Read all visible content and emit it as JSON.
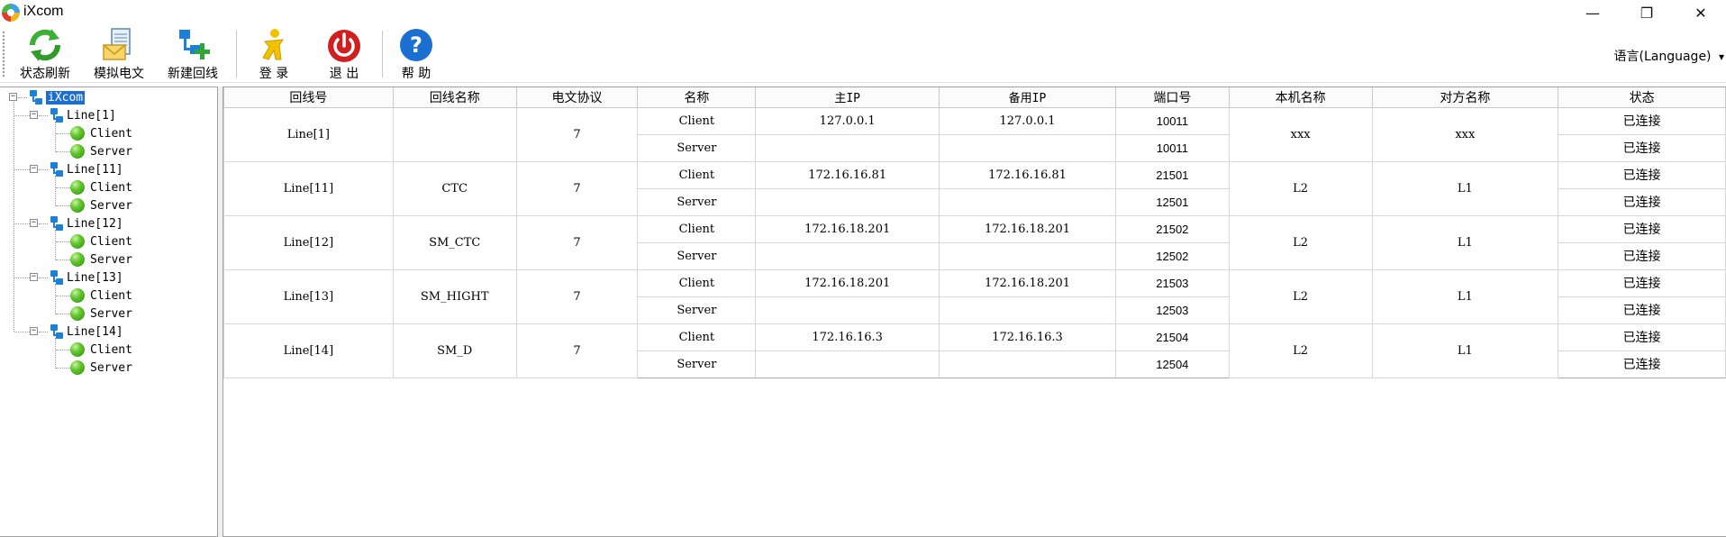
{
  "window": {
    "title": "iXcom",
    "minimize_glyph": "—",
    "restore_glyph": "❐",
    "close_glyph": "✕"
  },
  "toolbar": {
    "buttons": [
      {
        "label": "状态刷新",
        "icon": "refresh-icon"
      },
      {
        "label": "模拟电文",
        "icon": "message-icon"
      },
      {
        "label": "新建回线",
        "icon": "new-line-icon"
      },
      {
        "label": "登 录",
        "icon": "login-icon"
      },
      {
        "label": "退 出",
        "icon": "power-icon"
      },
      {
        "label": "帮 助",
        "icon": "help-icon"
      }
    ],
    "language": "语言(Language)",
    "language_arrow": "▾"
  },
  "tree": {
    "root": "iXcom",
    "lines": [
      {
        "label": "Line[1]",
        "children": [
          "Client",
          "Server"
        ]
      },
      {
        "label": "Line[11]",
        "children": [
          "Client",
          "Server"
        ]
      },
      {
        "label": "Line[12]",
        "children": [
          "Client",
          "Server"
        ]
      },
      {
        "label": "Line[13]",
        "children": [
          "Client",
          "Server"
        ]
      },
      {
        "label": "Line[14]",
        "children": [
          "Client",
          "Server"
        ]
      }
    ]
  },
  "table": {
    "columns": [
      "回线号",
      "回线名称",
      "电文协议",
      "名称",
      "主IP",
      "备用IP",
      "端口号",
      "本机名称",
      "对方名称",
      "状态"
    ],
    "groups": [
      {
        "line": "Line[1]",
        "name": "",
        "protocol": "7",
        "local": "xxx",
        "remote": "xxx",
        "rows": [
          {
            "role": "Client",
            "main_ip": "127.0.0.1",
            "backup_ip": "127.0.0.1",
            "port": "10011",
            "status": "已连接"
          },
          {
            "role": "Server",
            "main_ip": "",
            "backup_ip": "",
            "port": "10011",
            "status": "已连接"
          }
        ]
      },
      {
        "line": "Line[11]",
        "name": "CTC",
        "protocol": "7",
        "local": "L2",
        "remote": "L1",
        "rows": [
          {
            "role": "Client",
            "main_ip": "172.16.16.81",
            "backup_ip": "172.16.16.81",
            "port": "21501",
            "status": "已连接"
          },
          {
            "role": "Server",
            "main_ip": "",
            "backup_ip": "",
            "port": "12501",
            "status": "已连接"
          }
        ]
      },
      {
        "line": "Line[12]",
        "name": "SM_CTC",
        "protocol": "7",
        "local": "L2",
        "remote": "L1",
        "rows": [
          {
            "role": "Client",
            "main_ip": "172.16.18.201",
            "backup_ip": "172.16.18.201",
            "port": "21502",
            "status": "已连接"
          },
          {
            "role": "Server",
            "main_ip": "",
            "backup_ip": "",
            "port": "12502",
            "status": "已连接"
          }
        ]
      },
      {
        "line": "Line[13]",
        "name": "SM_HIGHT",
        "protocol": "7",
        "local": "L2",
        "remote": "L1",
        "rows": [
          {
            "role": "Client",
            "main_ip": "172.16.18.201",
            "backup_ip": "172.16.18.201",
            "port": "21503",
            "status": "已连接"
          },
          {
            "role": "Server",
            "main_ip": "",
            "backup_ip": "",
            "port": "12503",
            "status": "已连接"
          }
        ]
      },
      {
        "line": "Line[14]",
        "name": "SM_D",
        "protocol": "7",
        "local": "L2",
        "remote": "L1",
        "rows": [
          {
            "role": "Client",
            "main_ip": "172.16.16.3",
            "backup_ip": "172.16.16.3",
            "port": "21504",
            "status": "已连接"
          },
          {
            "role": "Server",
            "main_ip": "",
            "backup_ip": "",
            "port": "12504",
            "status": "已连接"
          }
        ]
      }
    ]
  }
}
